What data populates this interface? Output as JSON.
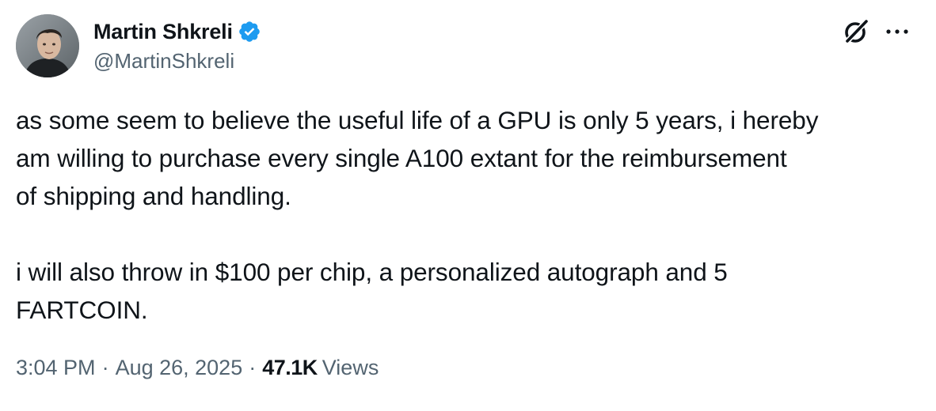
{
  "author": {
    "display_name": "Martin Shkreli",
    "handle": "@MartinShkreli",
    "verified": true,
    "verified_color": "#1d9bf0",
    "avatar_icon": "profile-photo"
  },
  "header_actions": {
    "grok_icon": "grok-icon",
    "more_icon": "more-dots-icon"
  },
  "tweet": {
    "paragraphs": [
      "as some seem to believe the useful life of a GPU is only 5 years, i hereby\nam willing to purchase every single A100 extant for the reimbursement\nof shipping and handling.",
      "i will also throw in $100 per chip, a personalized autograph and 5\nFARTCOIN."
    ]
  },
  "meta": {
    "time": "3:04 PM",
    "separator": "·",
    "date": "Aug 26, 2025",
    "views_count": "47.1K",
    "views_label": "Views"
  },
  "colors": {
    "text_primary": "#0f1419",
    "text_secondary": "#536471"
  }
}
